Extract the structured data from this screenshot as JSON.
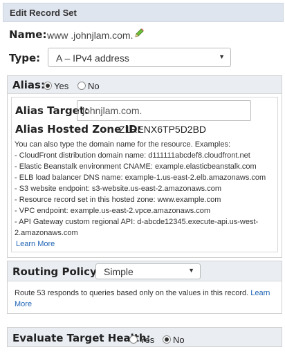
{
  "title": "Edit Record Set",
  "name": {
    "label": "Name:",
    "value": "www .johnjlam.com."
  },
  "type": {
    "label": "Type:",
    "value": "A – IPv4 address"
  },
  "alias": {
    "label": "Alias:",
    "yes": "Yes",
    "no": "No",
    "selected": "Yes",
    "target_label": "Alias Target:",
    "target_value": "johnjlam.com.",
    "zone_label": "Alias Hosted Zone ID:",
    "zone_value": "Z1RENX6TP5D2BD",
    "intro": "You can also type the domain name for the resource. Examples:",
    "examples": [
      "-  CloudFront distribution domain name: d111111abcdef8.cloudfront.net",
      "-  Elastic Beanstalk environment CNAME: example.elasticbeanstalk.com",
      "-  ELB load balancer DNS name: example-1.us-east-2.elb.amazonaws.com",
      "-  S3 website endpoint: s3-website.us-east-2.amazonaws.com",
      "-  Resource record set in this hosted zone: www.example.com",
      "-  VPC endpoint: example.us-east-2.vpce.amazonaws.com",
      "-  API Gateway custom regional API: d-abcde12345.execute-api.us-west-",
      "   2.amazonaws.com"
    ],
    "learn_more": "Learn More"
  },
  "routing": {
    "label": "Routing Policy:",
    "value": "Simple",
    "desc": "Route 53 responds to queries based only on the values in this record.",
    "learn": "Learn",
    "more": "More"
  },
  "health": {
    "label": "Evaluate Target Health:",
    "yes": "Yes",
    "no": "No",
    "selected": "No"
  }
}
